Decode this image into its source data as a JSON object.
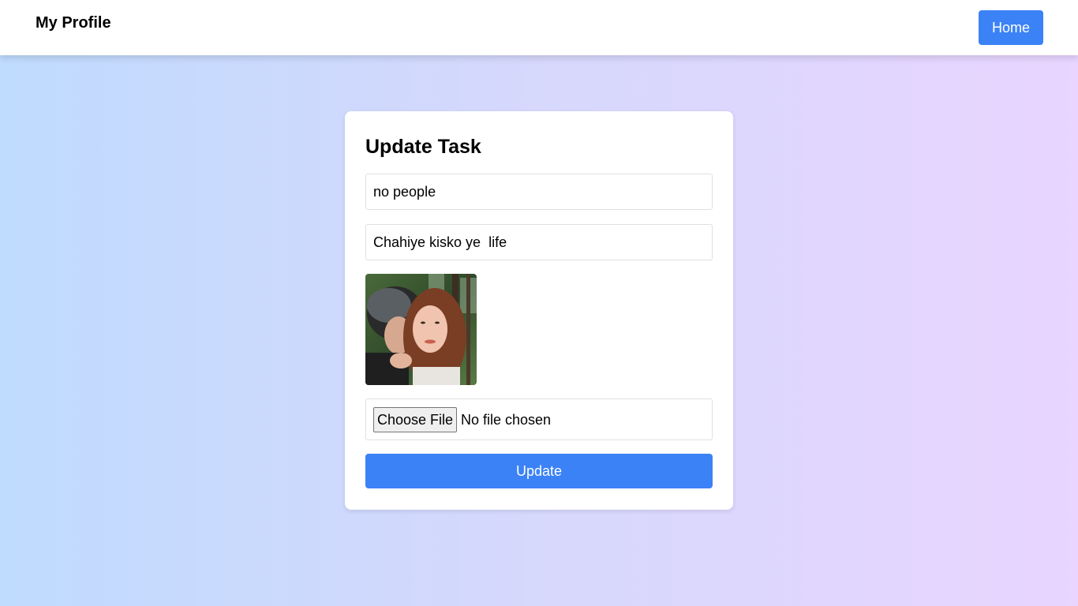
{
  "navbar": {
    "brand": "My Profile",
    "home_label": "Home"
  },
  "form": {
    "title": "Update Task",
    "task_title_value": "no people",
    "task_description_value": "Chahiye kisko ye  life",
    "preview_alt": "task image preview",
    "file": {
      "button_label": "Choose File",
      "status": "No file chosen"
    },
    "submit_label": "Update"
  },
  "colors": {
    "accent": "#3b82f6",
    "background_start": "#bfdbfe",
    "background_end": "#e9d5ff",
    "card": "#ffffff"
  }
}
